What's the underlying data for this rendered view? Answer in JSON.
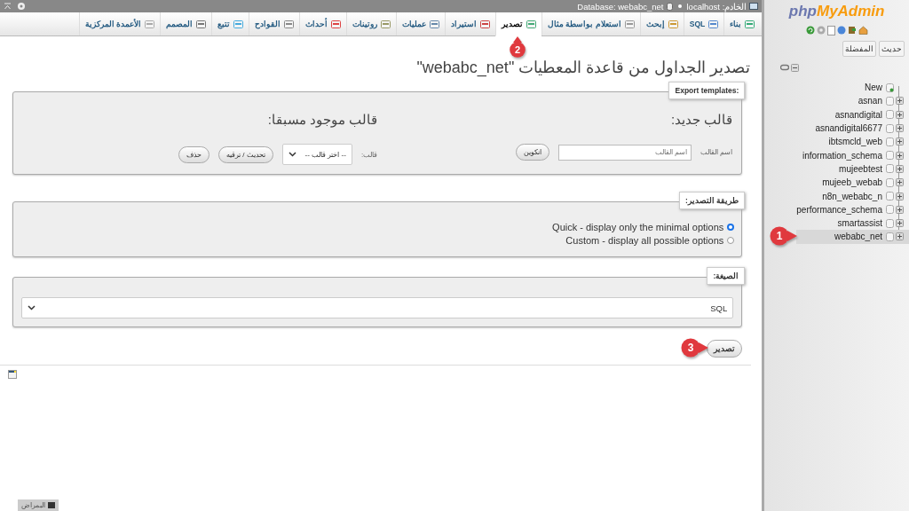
{
  "topbar": {
    "breadcrumbs": [
      {
        "kind": "server",
        "label": "الخادم: localhost"
      },
      {
        "kind": "database",
        "label": "Database: webabc_net"
      }
    ]
  },
  "tabs": [
    {
      "label": "بناء",
      "selected": false
    },
    {
      "label": "SQL",
      "selected": false
    },
    {
      "label": "إبحث",
      "selected": false
    },
    {
      "label": "استعلام بواسطة مثال",
      "selected": false
    },
    {
      "label": "تصدير",
      "selected": true
    },
    {
      "label": "استيراد",
      "selected": false
    },
    {
      "label": "عمليات",
      "selected": false
    },
    {
      "label": "روتينات",
      "selected": false
    },
    {
      "label": "أحداث",
      "selected": false
    },
    {
      "label": "القوادح",
      "selected": false
    },
    {
      "label": "تتبع",
      "selected": false
    },
    {
      "label": "المصمم",
      "selected": false
    },
    {
      "label": "الأعمدة المركزية",
      "selected": false
    }
  ],
  "page_title": "تصدير الجداول من قاعدة المعطيات \"webabc_net\"",
  "export_templates": {
    "legend": "Export templates:",
    "new_heading": "قالب جديد:",
    "name_label": "اسم القالب",
    "name_placeholder": "اسم القالب",
    "create_button": "انكوين",
    "existing_heading": "قالب موجود مسبقا:",
    "template_label": "قالب:",
    "template_select": "-- اختر قالب --",
    "update_button": "تحديث / ترقيه",
    "delete_button": "حذف"
  },
  "export_method": {
    "legend": "طريقة التصدير:",
    "options": [
      {
        "label": "Quick - display only the minimal options",
        "selected": true
      },
      {
        "label": "Custom - display all possible options",
        "selected": false
      }
    ]
  },
  "format": {
    "legend": "الصيغة:",
    "value": "SQL"
  },
  "export_button": "تصدير",
  "console_tab": "البمراض",
  "sidebar": {
    "logo_php": "php",
    "logo_myadmin": "MyAdmin",
    "buttons": [
      "حديث",
      "المفضلة"
    ],
    "databases": [
      {
        "name": "New",
        "selected": false
      },
      {
        "name": "asnan",
        "selected": false
      },
      {
        "name": "asnandigital",
        "selected": false
      },
      {
        "name": "asnandigital6677",
        "selected": false
      },
      {
        "name": "ibtsmcld_web",
        "selected": false
      },
      {
        "name": "information_schema",
        "selected": false
      },
      {
        "name": "mujeebtest",
        "selected": false
      },
      {
        "name": "mujeeb_webab",
        "selected": false
      },
      {
        "name": "n8n_webabc_n",
        "selected": false
      },
      {
        "name": "performance_schema",
        "selected": false
      },
      {
        "name": "smartassist",
        "selected": false
      },
      {
        "name": "webabc_net",
        "selected": true
      }
    ]
  },
  "step_markers": [
    {
      "label": "1"
    },
    {
      "label": "2"
    },
    {
      "label": "3"
    }
  ]
}
